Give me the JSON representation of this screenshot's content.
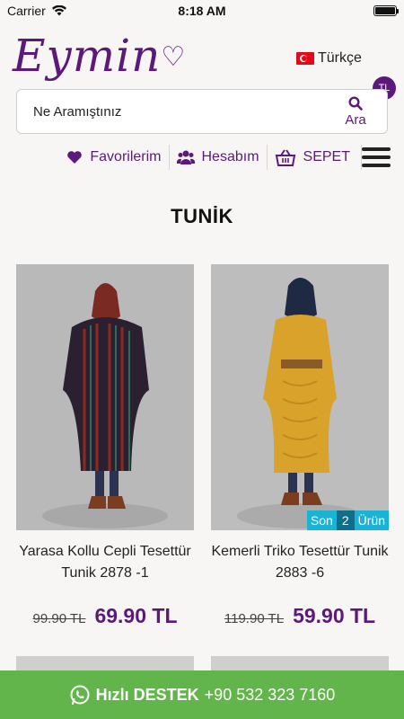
{
  "status": {
    "carrier": "Carrier",
    "time": "8:18 AM"
  },
  "header": {
    "logo_text": "Eymin",
    "language": "Türkçe",
    "currency": "TL"
  },
  "search": {
    "placeholder": "Ne Aramıştınız",
    "button_label": "Ara"
  },
  "toolbar": {
    "favorites": "Favorilerim",
    "account": "Hesabım",
    "cart": "SEPET"
  },
  "page": {
    "title": "TUNİK"
  },
  "products": [
    {
      "name": "Yarasa Kollu Cepli Tesettür Tunik 2878 -1",
      "old_price": "99.90 TL",
      "new_price": "69.90 TL"
    },
    {
      "name": "Kemerli Triko Tesettür Tunik 2883 -6",
      "old_price": "119.90 TL",
      "new_price": "59.90 TL",
      "badge": {
        "pre": "Son",
        "num": "2",
        "post": "Ürün"
      }
    }
  ],
  "support": {
    "label": "Hızlı DESTEK",
    "phone": "+90 532 323 7160"
  },
  "colors": {
    "brand": "#5b1a7a",
    "support_bg": "#62b54a",
    "badge": "#1ab3d6"
  }
}
